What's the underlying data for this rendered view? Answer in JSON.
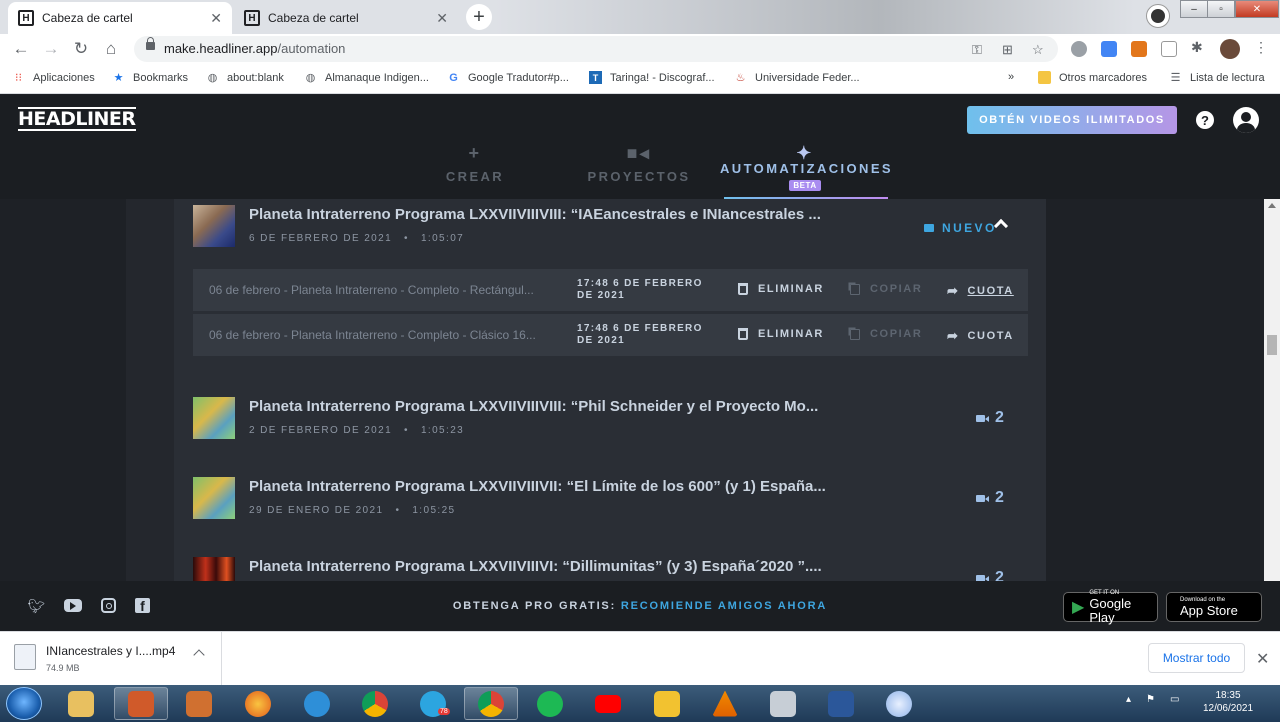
{
  "browser": {
    "tabs": [
      {
        "title": "Cabeza de cartel",
        "active": true
      },
      {
        "title": "Cabeza de cartel",
        "active": false
      }
    ],
    "url_domain": "make.headliner.app",
    "url_path": "/automation",
    "bookmarks": [
      {
        "label": "Aplicaciones",
        "icon": "apps-grid-icon"
      },
      {
        "label": "Bookmarks",
        "icon": "star-icon"
      },
      {
        "label": "about:blank",
        "icon": "globe-icon"
      },
      {
        "label": "Almanaque Indigen...",
        "icon": "globe-icon"
      },
      {
        "label": "Google Tradutor#p...",
        "icon": "google-icon"
      },
      {
        "label": "Taringa! - Discograf...",
        "icon": "taringa-icon"
      },
      {
        "label": "Universidade Feder...",
        "icon": "university-icon"
      }
    ],
    "bookmarks_overflow": "»",
    "other_bookmarks": "Otros marcadores",
    "reading_list": "Lista de lectura"
  },
  "app": {
    "logo": "HEADLINER",
    "promo_button": "OBTÉN VIDEOS ILIMITADOS",
    "nav": [
      {
        "label": "CREAR",
        "icon": "plus-icon"
      },
      {
        "label": "PROYECTOS",
        "icon": "video-camera-icon"
      },
      {
        "label": "AUTOMATIZACIONES",
        "icon": "magic-wand-icon",
        "badge": "BETA",
        "active": true
      }
    ],
    "accent_color": "#3ea6e0",
    "expanded_project": {
      "title": "Planeta Intraterreno Programa LXXVIIVIIIVIII: “IAEancestrales e INIancestrales ...",
      "date": "6 DE FEBRERO DE 2021",
      "duration": "1:05:07",
      "status": "NUEVO",
      "videos": [
        {
          "name": "06 de febrero - Planeta Intraterreno - Completo - Rectángul...",
          "date_line1": "17:48 6 DE FEBRERO",
          "date_line2": "DE 2021",
          "delete": "ELIMINAR",
          "copy": "COPIAR",
          "share": "CUOTA"
        },
        {
          "name": "06 de febrero - Planeta Intraterreno - Completo - Clásico 16...",
          "date_line1": "17:48 6 DE FEBRERO",
          "date_line2": "DE 2021",
          "delete": "ELIMINAR",
          "copy": "COPIAR",
          "share": "CUOTA"
        }
      ]
    },
    "projects": [
      {
        "title": "Planeta Intraterreno Programa LXXVIIVIIIVIII: “Phil Schneider y el Proyecto Mo...",
        "date": "2 DE FEBRERO DE 2021",
        "duration": "1:05:23",
        "count": "2"
      },
      {
        "title": "Planeta Intraterreno Programa LXXVIIVIIIVII: “El Límite de los 600” (y 1) España...",
        "date": "29 DE ENERO DE 2021",
        "duration": "1:05:25",
        "count": "2"
      },
      {
        "title": "Planeta Intraterreno Programa LXXVIIVIIIVI: “Dillimunitas” (y 3) España´2020 ”....",
        "date": "",
        "duration": "",
        "count": "2"
      }
    ],
    "footer": {
      "text": "OBTENGA PRO GRATIS:",
      "link": "RECOMIENDE AMIGOS AHORA",
      "google_play_small": "GET IT ON",
      "google_play": "Google Play",
      "app_store_small": "Download on the",
      "app_store": "App Store"
    }
  },
  "downloads": {
    "file_name": "INIancestrales y I....mp4",
    "file_size": "74.9 MB",
    "show_all": "Mostrar todo"
  },
  "taskbar": {
    "time": "18:35",
    "date": "12/06/2021",
    "telegram_badge": "78"
  }
}
